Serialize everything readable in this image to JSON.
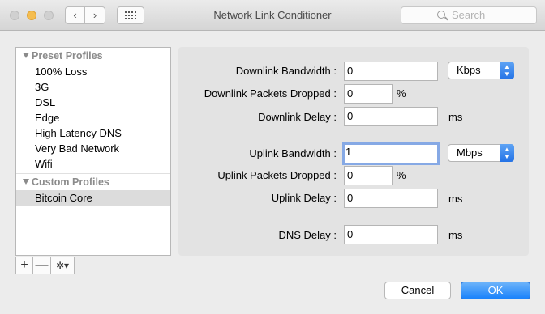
{
  "window": {
    "title": "Network Link Conditioner",
    "search_placeholder": "Search"
  },
  "sidebar": {
    "preset_header": "Preset Profiles",
    "preset_items": [
      "100% Loss",
      "3G",
      "DSL",
      "Edge",
      "High Latency DNS",
      "Very Bad Network",
      "Wifi"
    ],
    "custom_header": "Custom Profiles",
    "custom_items": [
      "Bitcoin Core"
    ],
    "selected": "Bitcoin Core"
  },
  "toolbar": {
    "add": "+",
    "remove": "—",
    "gear": "✲▾"
  },
  "form": {
    "downlink_bandwidth_label": "Downlink Bandwidth :",
    "downlink_bandwidth_value": "0",
    "downlink_bandwidth_unit": "Kbps",
    "downlink_dropped_label": "Downlink Packets Dropped :",
    "downlink_dropped_value": "0",
    "downlink_dropped_unit": "%",
    "downlink_delay_label": "Downlink Delay :",
    "downlink_delay_value": "0",
    "downlink_delay_unit": "ms",
    "uplink_bandwidth_label": "Uplink Bandwidth :",
    "uplink_bandwidth_value": "1",
    "uplink_bandwidth_unit": "Mbps",
    "uplink_dropped_label": "Uplink Packets Dropped :",
    "uplink_dropped_value": "0",
    "uplink_dropped_unit": "%",
    "uplink_delay_label": "Uplink Delay :",
    "uplink_delay_value": "0",
    "uplink_delay_unit": "ms",
    "dns_delay_label": "DNS Delay :",
    "dns_delay_value": "0",
    "dns_delay_unit": "ms"
  },
  "buttons": {
    "cancel": "Cancel",
    "ok": "OK"
  },
  "colors": {
    "accent": "#1a82fb",
    "focus_ring": "#86a9e5"
  }
}
